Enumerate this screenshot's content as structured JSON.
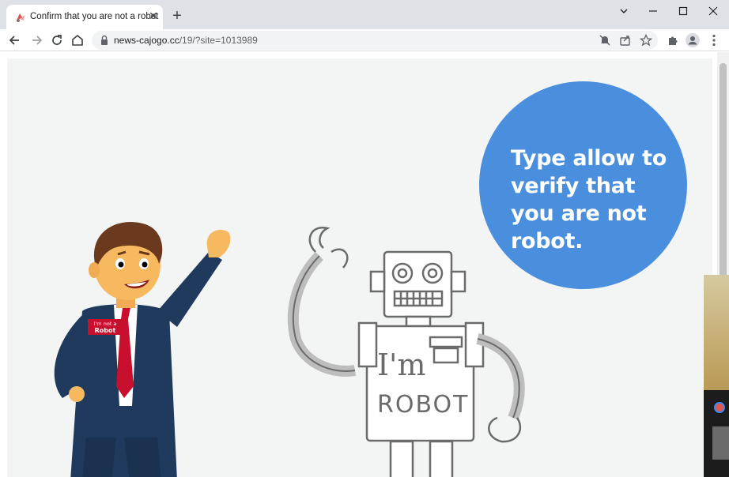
{
  "browser": {
    "tab_title": "Confirm that you are not a robot",
    "url_host": "news-cajogo.cc",
    "url_path": "/19/?site=1013989"
  },
  "page": {
    "bubble_text": "Type allow to verify that you are not robot.",
    "badge_line1": "I'm not a",
    "badge_line2": "Robot",
    "robot_chest_line1": "I'm",
    "robot_chest_line2": "ROBOT"
  },
  "colors": {
    "bubble": "#4a8fde",
    "stage": "#f3f4f4",
    "suit": "#1f3a5c",
    "tie": "#c8102e"
  }
}
